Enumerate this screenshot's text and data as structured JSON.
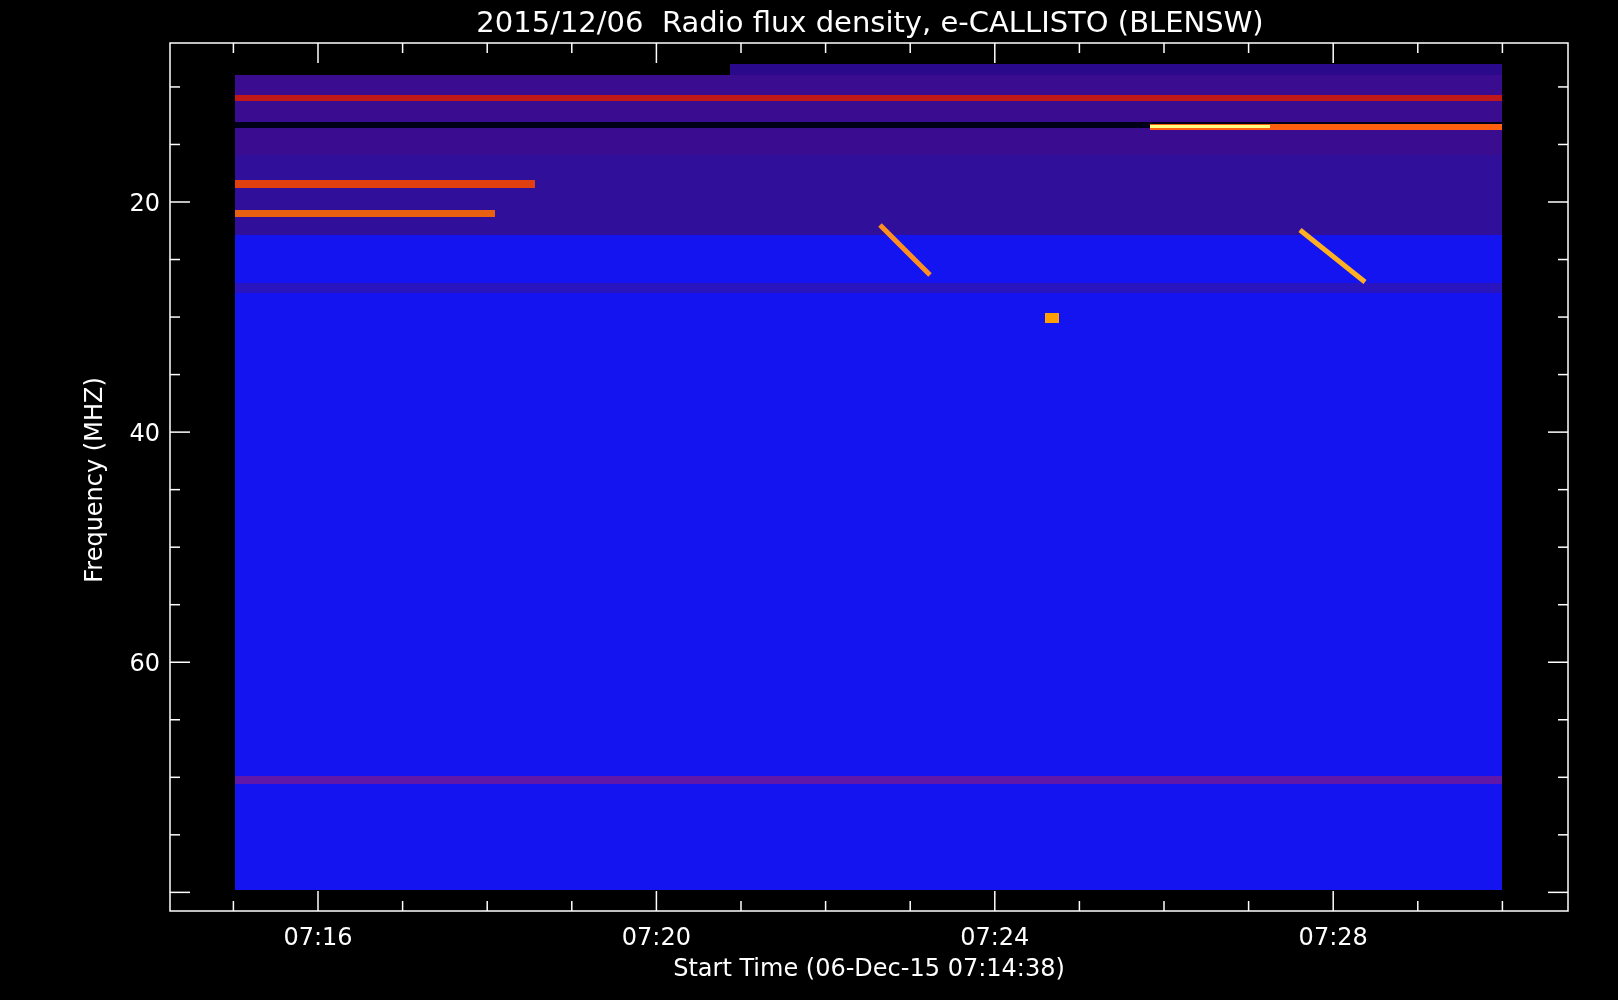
{
  "chart": {
    "title": "2015/12/06  Radio flux density, e-CALLISTO (BLENSW)",
    "ylabel": "Frequency (MHZ)",
    "xlabel": "Start Time (06-Dec-15 07:14:38)",
    "yticks": [
      "20",
      "40",
      "60"
    ],
    "xticks": [
      "07:16",
      "07:20",
      "07:24",
      "07:28"
    ]
  }
}
